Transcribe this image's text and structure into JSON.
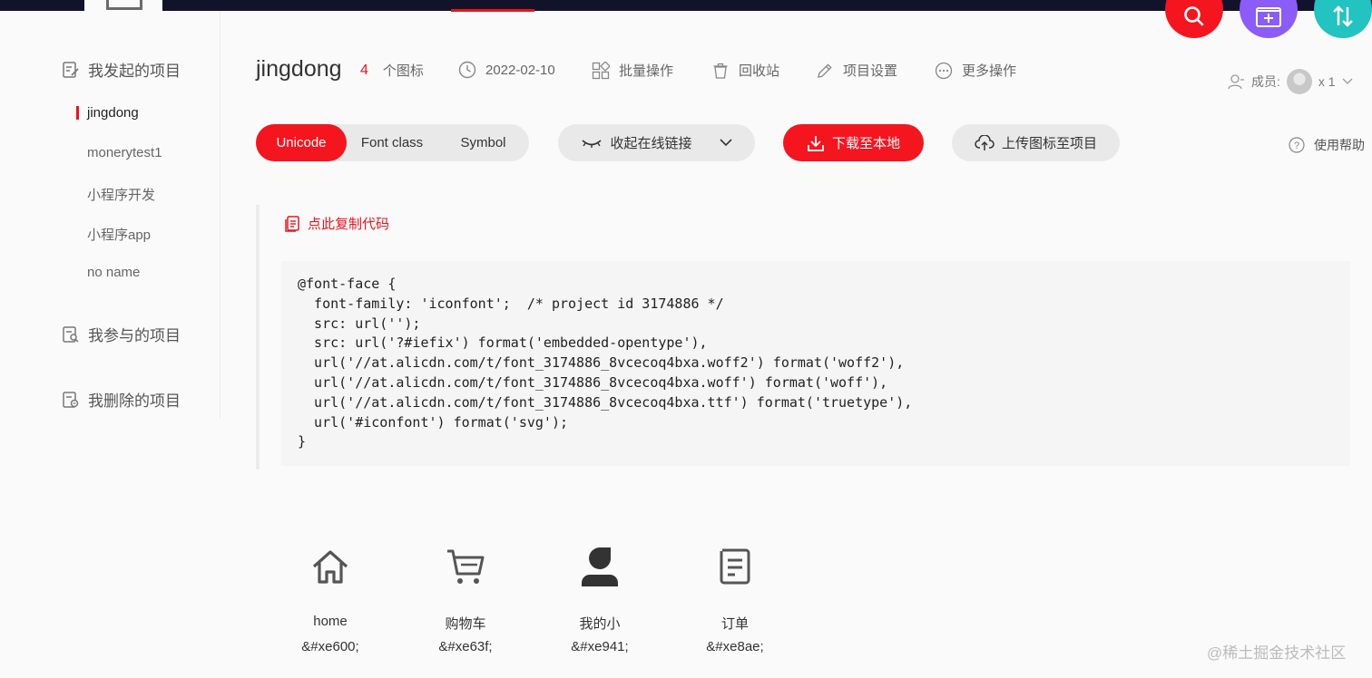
{
  "sidebar": {
    "groups": [
      {
        "label": "我发起的项目",
        "icon": "edit-doc-icon"
      },
      {
        "label": "我参与的项目",
        "icon": "search-doc-icon"
      },
      {
        "label": "我删除的项目",
        "icon": "trash-doc-icon"
      }
    ],
    "projects": [
      "jingdong",
      "monerytest1",
      "小程序开发",
      "小程序app",
      "no name"
    ],
    "active_project": "jingdong"
  },
  "header": {
    "title": "jingdong",
    "icon_count": "4",
    "icon_count_label": "个图标",
    "date": "2022-02-10",
    "batch": "批量操作",
    "recycle": "回收站",
    "settings": "项目设置",
    "more": "更多操作",
    "members_label": "成员:",
    "members_count": "x 1"
  },
  "toolbar": {
    "tabs": [
      "Unicode",
      "Font class",
      "Symbol"
    ],
    "active_tab": "Unicode",
    "collapse_link": "收起在线链接",
    "download": "下载至本地",
    "upload": "上传图标至项目",
    "help": "使用帮助"
  },
  "code_panel": {
    "copy_label": "点此复制代码",
    "code": "@font-face {\n  font-family: 'iconfont';  /* project id 3174886 */\n  src: url('');\n  src: url('?#iefix') format('embedded-opentype'),\n  url('//at.alicdn.com/t/font_3174886_8vcecoq4bxa.woff2') format('woff2'),\n  url('//at.alicdn.com/t/font_3174886_8vcecoq4bxa.woff') format('woff'),\n  url('//at.alicdn.com/t/font_3174886_8vcecoq4bxa.ttf') format('truetype'),\n  url('#iconfont') format('svg');\n}"
  },
  "icons": [
    {
      "name": "home",
      "code": "&#xe600;",
      "icon": "home-icon"
    },
    {
      "name": "购物车",
      "code": "&#xe63f;",
      "icon": "cart-icon"
    },
    {
      "name": "我的小",
      "code": "&#xe941;",
      "icon": "user-icon"
    },
    {
      "name": "订单",
      "code": "&#xe8ae;",
      "icon": "order-icon"
    }
  ],
  "watermark": "@稀土掘金技术社区",
  "colors": {
    "accent": "#f5151f",
    "purple": "#8b5cf6",
    "teal": "#22c3c0",
    "dark_bar": "#12122a"
  }
}
